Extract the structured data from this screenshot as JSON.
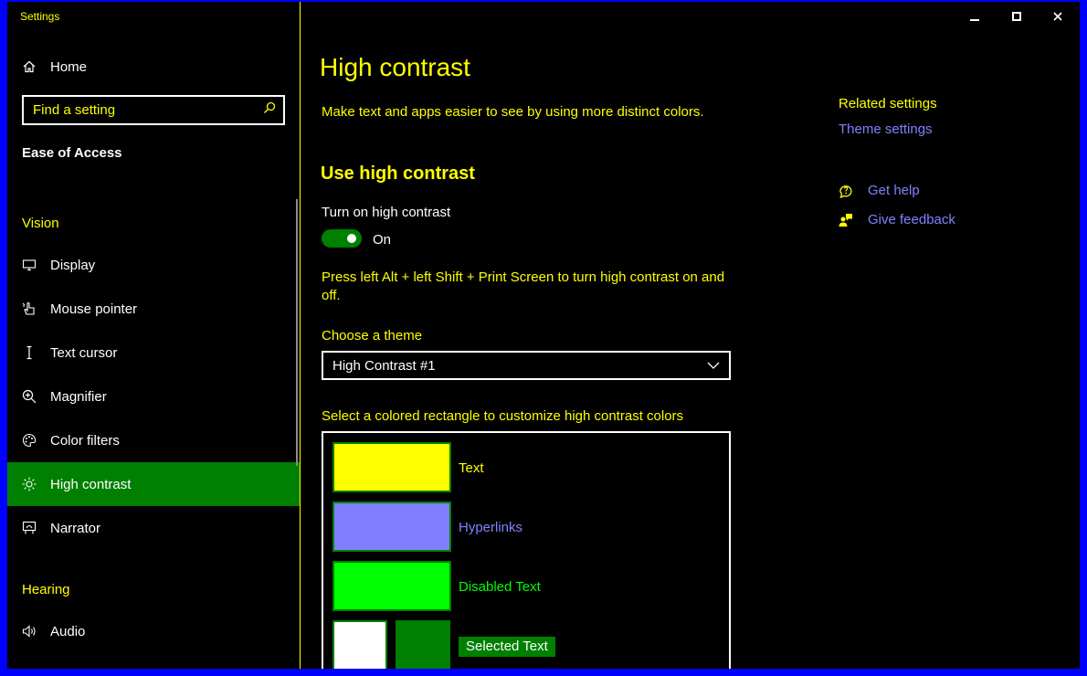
{
  "window": {
    "title": "Settings",
    "controls": {
      "minimize_icon": "minimize-icon",
      "maximize_icon": "maximize-icon",
      "close_icon": "close-icon"
    }
  },
  "sidebar": {
    "home_label": "Home",
    "search": {
      "placeholder": "Find a setting",
      "value": ""
    },
    "category": "Ease of Access",
    "groups": [
      {
        "label": "Vision",
        "items": [
          {
            "label": "Display",
            "icon": "monitor-icon"
          },
          {
            "label": "Mouse pointer",
            "icon": "mouse-pointer-icon"
          },
          {
            "label": "Text cursor",
            "icon": "text-cursor-icon"
          },
          {
            "label": "Magnifier",
            "icon": "magnifier-icon"
          },
          {
            "label": "Color filters",
            "icon": "color-palette-icon"
          },
          {
            "label": "High contrast",
            "icon": "brightness-icon",
            "selected": true
          },
          {
            "label": "Narrator",
            "icon": "narrator-icon"
          }
        ]
      },
      {
        "label": "Hearing",
        "items": [
          {
            "label": "Audio",
            "icon": "speaker-icon"
          }
        ]
      }
    ]
  },
  "main": {
    "title": "High contrast",
    "description": "Make text and apps easier to see by using more distinct colors.",
    "section_title": "Use high contrast",
    "toggle": {
      "label": "Turn on high contrast",
      "state": "On",
      "on": true
    },
    "shortcut_text": "Press left Alt + left Shift + Print Screen to turn high contrast on and off.",
    "theme": {
      "label": "Choose a theme",
      "selected": "High Contrast #1"
    },
    "colors": {
      "label": "Select a colored rectangle to customize high contrast colors",
      "items": [
        {
          "label": "Text",
          "swatch": "#ffff00",
          "text_color": "#ffff00"
        },
        {
          "label": "Hyperlinks",
          "swatch": "#8080ff",
          "text_color": "#8080ff"
        },
        {
          "label": "Disabled Text",
          "swatch": "#00ff00",
          "text_color": "#00ff00"
        },
        {
          "label": "Selected Text",
          "swatch_fg": "#ffffff",
          "swatch_bg": "#008000"
        }
      ]
    }
  },
  "related": {
    "heading": "Related settings",
    "theme_link": "Theme settings",
    "get_help": "Get help",
    "give_feedback": "Give feedback"
  },
  "colors": {
    "background": "#000000",
    "frame": "#0000ff",
    "accent_text": "#ffff00",
    "hyperlink": "#8080ff",
    "selected_bg": "#008000"
  }
}
